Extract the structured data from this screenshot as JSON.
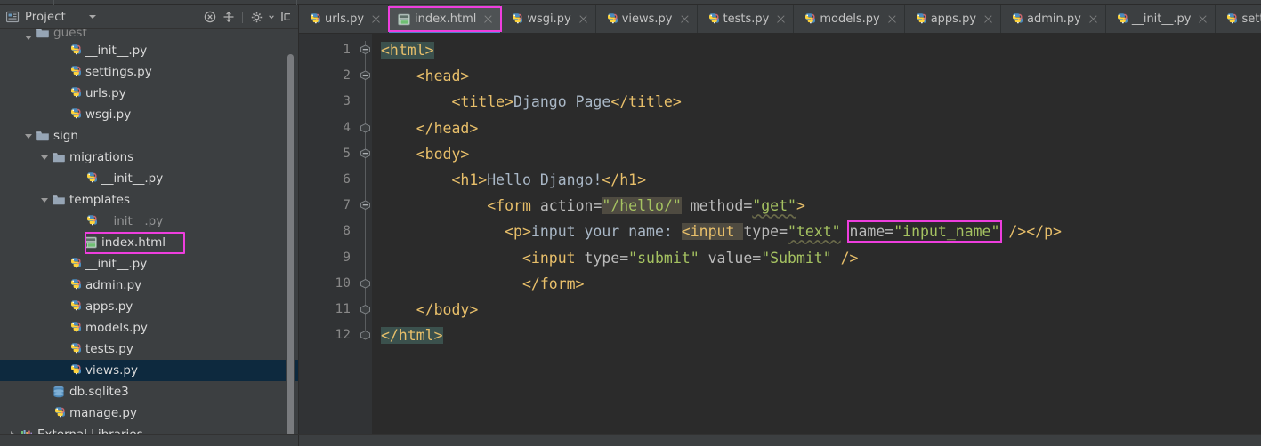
{
  "window": {
    "theme_bg": "#3c3f41",
    "editor_bg": "#2b2b2b",
    "accent_highlight": "#ee3ede",
    "selection_blue": "#0d293e",
    "active_tab_underline": "#4a88c7"
  },
  "project_panel": {
    "title": "Project",
    "caret_icon": "chevron-down-icon",
    "panel_icon": "project-view-icon",
    "toolbar": [
      {
        "name": "collapse-all-icon",
        "glyph": "circle-x"
      },
      {
        "name": "expand-select-icon",
        "glyph": "crosshair"
      },
      {
        "name": "separator",
        "glyph": "divider"
      },
      {
        "name": "settings-gear-icon",
        "glyph": "gear-dropdown"
      },
      {
        "name": "hide-panel-icon",
        "glyph": "hide-left"
      }
    ],
    "tree": [
      {
        "label": "guest",
        "indent": 1,
        "arrow": "down",
        "icon": "folder-icon",
        "cut": "top"
      },
      {
        "label": "__init__.py",
        "indent": 3,
        "arrow": "none",
        "icon": "python-icon"
      },
      {
        "label": "settings.py",
        "indent": 3,
        "arrow": "none",
        "icon": "python-icon"
      },
      {
        "label": "urls.py",
        "indent": 3,
        "arrow": "none",
        "icon": "python-icon"
      },
      {
        "label": "wsgi.py",
        "indent": 3,
        "arrow": "none",
        "icon": "python-icon"
      },
      {
        "label": "sign",
        "indent": 1,
        "arrow": "down",
        "icon": "folder-icon"
      },
      {
        "label": "migrations",
        "indent": 2,
        "arrow": "down",
        "icon": "folder-icon"
      },
      {
        "label": "__init__.py",
        "indent": 4,
        "arrow": "none",
        "icon": "python-icon"
      },
      {
        "label": "templates",
        "indent": 2,
        "arrow": "down",
        "icon": "folder-icon"
      },
      {
        "label": "__init__.py",
        "indent": 4,
        "arrow": "none",
        "icon": "python-icon",
        "dim": true
      },
      {
        "label": "index.html",
        "indent": 4,
        "arrow": "none",
        "icon": "html-icon",
        "highlighted": true
      },
      {
        "label": "__init__.py",
        "indent": 3,
        "arrow": "none",
        "icon": "python-icon"
      },
      {
        "label": "admin.py",
        "indent": 3,
        "arrow": "none",
        "icon": "python-icon"
      },
      {
        "label": "apps.py",
        "indent": 3,
        "arrow": "none",
        "icon": "python-icon"
      },
      {
        "label": "models.py",
        "indent": 3,
        "arrow": "none",
        "icon": "python-icon"
      },
      {
        "label": "tests.py",
        "indent": 3,
        "arrow": "none",
        "icon": "python-icon"
      },
      {
        "label": "views.py",
        "indent": 3,
        "arrow": "none",
        "icon": "python-icon",
        "selected": true
      },
      {
        "label": "db.sqlite3",
        "indent": 2,
        "arrow": "none",
        "icon": "database-icon"
      },
      {
        "label": "manage.py",
        "indent": 2,
        "arrow": "none",
        "icon": "python-icon"
      },
      {
        "label": "External Libraries",
        "indent": 0,
        "arrow": "right",
        "icon": "library-icon"
      }
    ]
  },
  "editor": {
    "tabs": [
      {
        "label": "urls.py",
        "icon": "python-icon",
        "active": false
      },
      {
        "label": "index.html",
        "icon": "html-icon",
        "active": true,
        "highlighted": true
      },
      {
        "label": "wsgi.py",
        "icon": "python-icon",
        "active": false
      },
      {
        "label": "views.py",
        "icon": "python-icon",
        "active": false
      },
      {
        "label": "tests.py",
        "icon": "python-icon",
        "active": false
      },
      {
        "label": "models.py",
        "icon": "python-icon",
        "active": false
      },
      {
        "label": "apps.py",
        "icon": "python-icon",
        "active": false
      },
      {
        "label": "admin.py",
        "icon": "python-icon",
        "active": false
      },
      {
        "label": "__init__.py",
        "icon": "python-icon",
        "active": false
      },
      {
        "label": "settings.py",
        "icon": "python-icon",
        "active": false
      }
    ],
    "line_numbers": [
      "1",
      "2",
      "3",
      "4",
      "5",
      "6",
      "7",
      "8",
      "9",
      "10",
      "11",
      "12"
    ],
    "fold_markers": [
      {
        "line": 1,
        "type": "collapse"
      },
      {
        "line": 2,
        "type": "collapse"
      },
      {
        "line": 3,
        "type": "none"
      },
      {
        "line": 4,
        "type": "end"
      },
      {
        "line": 5,
        "type": "collapse"
      },
      {
        "line": 6,
        "type": "none"
      },
      {
        "line": 7,
        "type": "collapse"
      },
      {
        "line": 8,
        "type": "none"
      },
      {
        "line": 9,
        "type": "none"
      },
      {
        "line": 10,
        "type": "end"
      },
      {
        "line": 11,
        "type": "end"
      },
      {
        "line": 12,
        "type": "end"
      }
    ],
    "code_lines": [
      {
        "n": 1,
        "indent": 0,
        "text": "<html>"
      },
      {
        "n": 2,
        "indent": 1,
        "text": "<head>"
      },
      {
        "n": 3,
        "indent": 2,
        "text": "<title>Django Page</title>"
      },
      {
        "n": 4,
        "indent": 1,
        "text": "</head>"
      },
      {
        "n": 5,
        "indent": 1,
        "text": "<body>"
      },
      {
        "n": 6,
        "indent": 2,
        "text": "<h1>Hello Django!</h1>"
      },
      {
        "n": 7,
        "indent": 3,
        "text": "<form action=\"/hello/\" method=\"get\">"
      },
      {
        "n": 8,
        "indent": 4,
        "text": "<p>input your name: <input type=\"text\" name=\"input_name\" /></p>"
      },
      {
        "n": 9,
        "indent": 5,
        "text": "<input type=\"submit\" value=\"Submit\" />"
      },
      {
        "n": 10,
        "indent": 5,
        "text": "</form>"
      },
      {
        "n": 11,
        "indent": 1,
        "text": "</body>"
      },
      {
        "n": 12,
        "indent": 0,
        "text": "</html>"
      }
    ],
    "tokens": {
      "l1": {
        "tag": "<html>"
      },
      "l2": {
        "tag": "<head>"
      },
      "l3": {
        "open": "<title>",
        "content": "Django Page",
        "close": "</title>"
      },
      "l4": {
        "tag": "</head>"
      },
      "l5": {
        "tag": "<body>"
      },
      "l6": {
        "open": "<h1>",
        "content": "Hello Django!",
        "close": "</h1>"
      },
      "l7": {
        "open": "<form ",
        "a1": "action=",
        "v1": "\"/hello/\"",
        "a2": " method=",
        "v2": "\"get\"",
        "close": ">"
      },
      "l8": {
        "p_open": "<p>",
        "content": "input your name: ",
        "inp": "<input ",
        "a1": "type=",
        "v1": "\"text\"",
        "a2": "name=",
        "v2": "\"input_name\"",
        "selfclose": " />",
        "p_close": "</p>"
      },
      "l9": {
        "inp": "<input ",
        "a1": "type=",
        "v1": "\"submit\"",
        "a2": " value=",
        "v2": "\"Submit\"",
        "selfclose": " />"
      },
      "l10": {
        "tag": "</form>"
      },
      "l11": {
        "tag": "</body>"
      },
      "l12": {
        "tag": "</html>"
      }
    }
  }
}
